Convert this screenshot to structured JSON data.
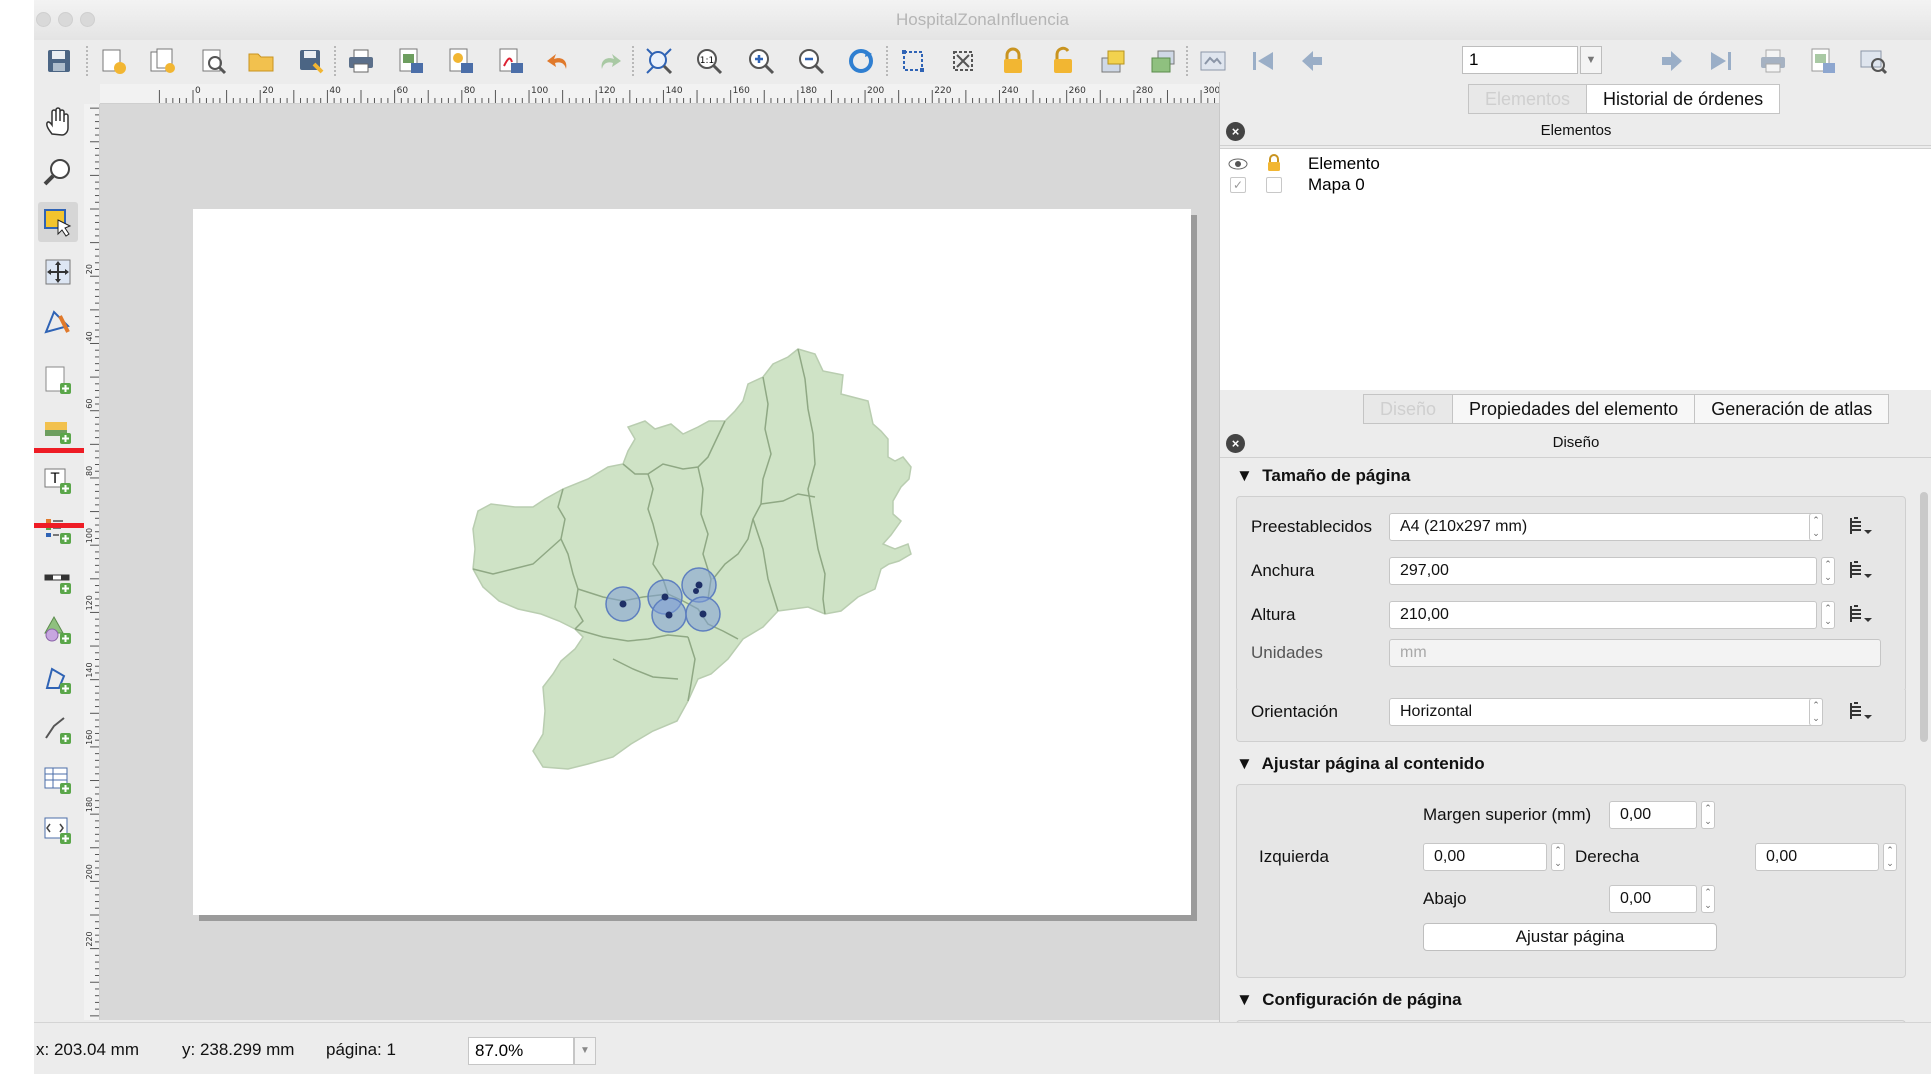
{
  "window": {
    "title": "HospitalZonaInfluencia"
  },
  "toolbar": {
    "page_number": "1",
    "icons": [
      "save-icon",
      "new-composer-icon",
      "duplicate-composer-icon",
      "composer-manager-icon",
      "open-template-icon",
      "save-template-icon",
      "print-icon",
      "export-image-icon",
      "export-svg-icon",
      "export-pdf-icon",
      "undo-icon",
      "redo-icon",
      "zoom-full-icon",
      "zoom-actual-icon",
      "zoom-in-icon",
      "zoom-out-icon",
      "refresh-icon",
      "select-all-icon",
      "deselect-icon",
      "lock-icon",
      "unlock-icon",
      "raise-icon",
      "lower-icon",
      "atlas-preview-icon",
      "first-feature-icon",
      "prev-feature-icon",
      "next-feature-icon",
      "last-feature-icon",
      "print-atlas-icon",
      "export-atlas-icon",
      "atlas-settings-icon"
    ]
  },
  "left_tools": [
    "pan-icon",
    "zoom-tool-icon",
    "select-move-icon",
    "move-content-icon",
    "edit-nodes-icon",
    "add-map-icon",
    "add-image-icon",
    "add-label-icon",
    "add-legend-icon",
    "add-scalebar-icon",
    "add-shape-icon",
    "add-polygon-icon",
    "add-polyline-icon",
    "add-table-icon",
    "add-html-icon"
  ],
  "ruler": {
    "h_labels": [
      "0",
      "20",
      "40",
      "60",
      "80",
      "100",
      "120",
      "140",
      "160",
      "180",
      "200",
      "220",
      "240",
      "260",
      "280",
      "300"
    ],
    "v_labels": [
      "20",
      "40",
      "60",
      "80",
      "100",
      "120",
      "140",
      "160",
      "180",
      "200",
      "220"
    ]
  },
  "items_panel": {
    "tabs": [
      "Elementos",
      "Historial de órdenes"
    ],
    "header": "Elementos",
    "rows": [
      {
        "name": "Elemento",
        "header": true
      },
      {
        "name": "Mapa 0",
        "header": false
      }
    ]
  },
  "props_panel": {
    "tabs": [
      "Diseño",
      "Propiedades del elemento",
      "Generación de atlas"
    ],
    "header": "Diseño",
    "page_size": {
      "section": "Tamaño de página",
      "preset_label": "Preestablecidos",
      "preset_value": "A4 (210x297 mm)",
      "width_label": "Anchura",
      "width_value": "297,00",
      "height_label": "Altura",
      "height_value": "210,00",
      "units_label": "Unidades",
      "units_value": "mm",
      "orientation_label": "Orientación",
      "orientation_value": "Horizontal"
    },
    "fit_page": {
      "section": "Ajustar página al contenido",
      "top_label": "Margen superior (mm)",
      "top_value": "0,00",
      "left_label": "Izquierda",
      "left_value": "0,00",
      "right_label": "Derecha",
      "right_value": "0,00",
      "bottom_label": "Abajo",
      "bottom_value": "0,00",
      "button": "Ajustar página"
    },
    "page_config": {
      "section": "Configuración de página"
    }
  },
  "status": {
    "x": "x: 203.04 mm",
    "y": "y: 238.299 mm",
    "page": "página: 1",
    "zoom": "87.0%"
  },
  "colors": {
    "map_fill": "#cfe3c6",
    "map_stroke": "#8fa884",
    "buffer": "#7f9fd6",
    "highlight": "#ee1c25"
  }
}
